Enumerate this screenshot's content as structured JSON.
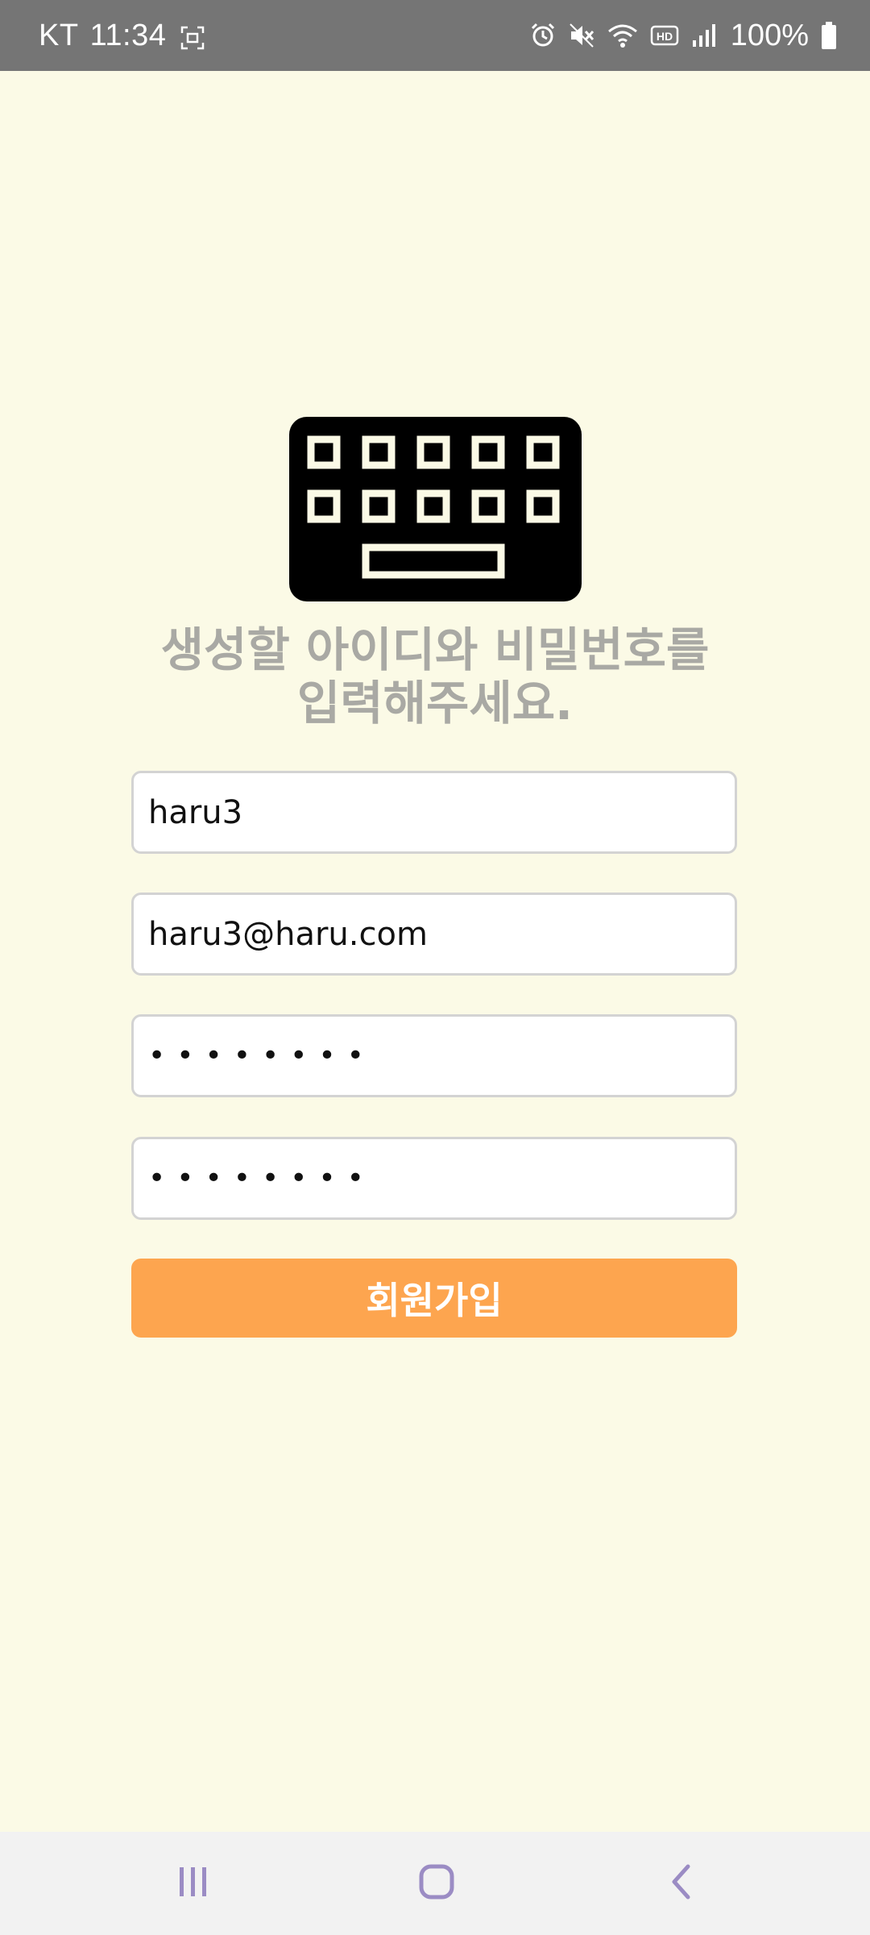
{
  "status_bar": {
    "carrier": "KT",
    "time": "11:34",
    "battery_percent": "100%",
    "icons": [
      "screen-record-icon",
      "alarm-icon",
      "mute-icon",
      "wifi-icon",
      "hd-icon",
      "signal-icon",
      "battery-icon"
    ]
  },
  "signup": {
    "logo_icon": "keyboard-icon",
    "heading_line1": "생성할 아이디와 비밀번호를",
    "heading_line2": "입력해주세요.",
    "id_value": "haru3",
    "email_value": "haru3@haru.com",
    "password_value": "••••••••",
    "password_confirm_value": "••••••••",
    "submit_label": "회원가입"
  },
  "nav_bar": {
    "icons": [
      "recent-apps-icon",
      "home-icon",
      "back-icon"
    ]
  },
  "colors": {
    "background": "#FBFAE6",
    "status_bar": "#757575",
    "heading": "#A9A9A4",
    "button": "#FDA54F",
    "nav_bar": "#F2F2F2",
    "nav_icon": "#9B8CC4"
  }
}
